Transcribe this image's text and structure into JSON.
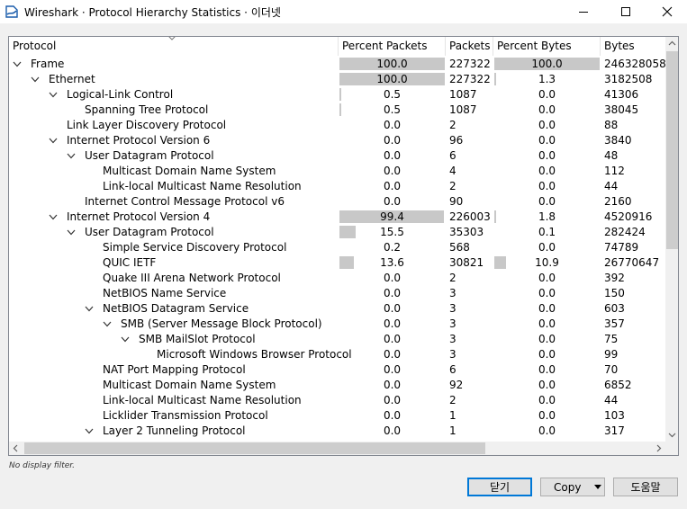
{
  "window": {
    "title": "Wireshark · Protocol Hierarchy Statistics · 이더넷",
    "controls": [
      "minimize-icon",
      "maximize-icon",
      "close-icon"
    ]
  },
  "columns": [
    "Protocol",
    "Percent Packets",
    "Packets",
    "Percent Bytes",
    "Bytes"
  ],
  "rows": [
    {
      "protocol": "Frame",
      "level": 0,
      "expanded": true,
      "pct_packets": "100.0",
      "packets": "227322",
      "pct_bytes": "100.0",
      "bytes": "246328058"
    },
    {
      "protocol": "Ethernet",
      "level": 1,
      "expanded": true,
      "pct_packets": "100.0",
      "packets": "227322",
      "pct_bytes": "1.3",
      "bytes": "3182508"
    },
    {
      "protocol": "Logical-Link Control",
      "level": 2,
      "expanded": true,
      "pct_packets": "0.5",
      "packets": "1087",
      "pct_bytes": "0.0",
      "bytes": "41306"
    },
    {
      "protocol": "Spanning Tree Protocol",
      "level": 3,
      "expanded": null,
      "pct_packets": "0.5",
      "packets": "1087",
      "pct_bytes": "0.0",
      "bytes": "38045"
    },
    {
      "protocol": "Link Layer Discovery Protocol",
      "level": 2,
      "expanded": null,
      "pct_packets": "0.0",
      "packets": "2",
      "pct_bytes": "0.0",
      "bytes": "88"
    },
    {
      "protocol": "Internet Protocol Version 6",
      "level": 2,
      "expanded": true,
      "pct_packets": "0.0",
      "packets": "96",
      "pct_bytes": "0.0",
      "bytes": "3840"
    },
    {
      "protocol": "User Datagram Protocol",
      "level": 3,
      "expanded": true,
      "pct_packets": "0.0",
      "packets": "6",
      "pct_bytes": "0.0",
      "bytes": "48"
    },
    {
      "protocol": "Multicast Domain Name System",
      "level": 4,
      "expanded": null,
      "pct_packets": "0.0",
      "packets": "4",
      "pct_bytes": "0.0",
      "bytes": "112"
    },
    {
      "protocol": "Link-local Multicast Name Resolution",
      "level": 4,
      "expanded": null,
      "pct_packets": "0.0",
      "packets": "2",
      "pct_bytes": "0.0",
      "bytes": "44"
    },
    {
      "protocol": "Internet Control Message Protocol v6",
      "level": 3,
      "expanded": null,
      "pct_packets": "0.0",
      "packets": "90",
      "pct_bytes": "0.0",
      "bytes": "2160"
    },
    {
      "protocol": "Internet Protocol Version 4",
      "level": 2,
      "expanded": true,
      "pct_packets": "99.4",
      "packets": "226003",
      "pct_bytes": "1.8",
      "bytes": "4520916"
    },
    {
      "protocol": "User Datagram Protocol",
      "level": 3,
      "expanded": true,
      "pct_packets": "15.5",
      "packets": "35303",
      "pct_bytes": "0.1",
      "bytes": "282424"
    },
    {
      "protocol": "Simple Service Discovery Protocol",
      "level": 4,
      "expanded": null,
      "pct_packets": "0.2",
      "packets": "568",
      "pct_bytes": "0.0",
      "bytes": "74789"
    },
    {
      "protocol": "QUIC IETF",
      "level": 4,
      "expanded": null,
      "pct_packets": "13.6",
      "packets": "30821",
      "pct_bytes": "10.9",
      "bytes": "26770647"
    },
    {
      "protocol": "Quake III Arena Network Protocol",
      "level": 4,
      "expanded": null,
      "pct_packets": "0.0",
      "packets": "2",
      "pct_bytes": "0.0",
      "bytes": "392"
    },
    {
      "protocol": "NetBIOS Name Service",
      "level": 4,
      "expanded": null,
      "pct_packets": "0.0",
      "packets": "3",
      "pct_bytes": "0.0",
      "bytes": "150"
    },
    {
      "protocol": "NetBIOS Datagram Service",
      "level": 4,
      "expanded": true,
      "pct_packets": "0.0",
      "packets": "3",
      "pct_bytes": "0.0",
      "bytes": "603"
    },
    {
      "protocol": "SMB (Server Message Block Protocol)",
      "level": 5,
      "expanded": true,
      "pct_packets": "0.0",
      "packets": "3",
      "pct_bytes": "0.0",
      "bytes": "357"
    },
    {
      "protocol": "SMB MailSlot Protocol",
      "level": 6,
      "expanded": true,
      "pct_packets": "0.0",
      "packets": "3",
      "pct_bytes": "0.0",
      "bytes": "75"
    },
    {
      "protocol": "Microsoft Windows Browser Protocol",
      "level": 7,
      "expanded": null,
      "pct_packets": "0.0",
      "packets": "3",
      "pct_bytes": "0.0",
      "bytes": "99"
    },
    {
      "protocol": "NAT Port Mapping Protocol",
      "level": 4,
      "expanded": null,
      "pct_packets": "0.0",
      "packets": "6",
      "pct_bytes": "0.0",
      "bytes": "70"
    },
    {
      "protocol": "Multicast Domain Name System",
      "level": 4,
      "expanded": null,
      "pct_packets": "0.0",
      "packets": "92",
      "pct_bytes": "0.0",
      "bytes": "6852"
    },
    {
      "protocol": "Link-local Multicast Name Resolution",
      "level": 4,
      "expanded": null,
      "pct_packets": "0.0",
      "packets": "2",
      "pct_bytes": "0.0",
      "bytes": "44"
    },
    {
      "protocol": "Licklider Transmission Protocol",
      "level": 4,
      "expanded": null,
      "pct_packets": "0.0",
      "packets": "1",
      "pct_bytes": "0.0",
      "bytes": "103"
    },
    {
      "protocol": "Layer 2 Tunneling Protocol",
      "level": 4,
      "expanded": true,
      "pct_packets": "0.0",
      "packets": "1",
      "pct_bytes": "0.0",
      "bytes": "317"
    }
  ],
  "scroll": {
    "vertical_position": 0.0,
    "horizontal_position": 0.0
  },
  "status": "No display filter.",
  "buttons": {
    "close": "닫기",
    "copy": "Copy",
    "help": "도움말"
  },
  "colors": {
    "bar": "#c8c8c8",
    "selection_border": "#0078d7"
  }
}
